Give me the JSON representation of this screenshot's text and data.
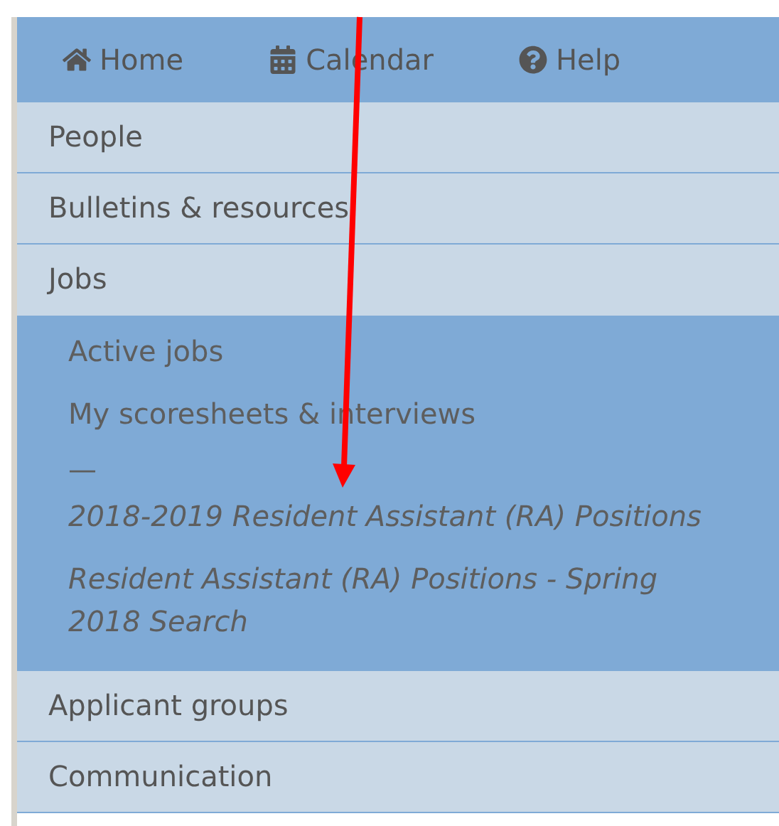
{
  "top_nav": [
    {
      "kind": "home",
      "label": "Home"
    },
    {
      "kind": "calendar",
      "label": "Calendar"
    },
    {
      "kind": "help",
      "label": "Help"
    }
  ],
  "menu": [
    {
      "label": "People",
      "expanded": false
    },
    {
      "label": "Bulletins & resources",
      "expanded": false
    },
    {
      "label": "Jobs",
      "expanded": true,
      "children": [
        {
          "kind": "link",
          "label": "Active jobs"
        },
        {
          "kind": "link",
          "label": "My scoresheets & interviews"
        },
        {
          "kind": "divider",
          "label": "—"
        },
        {
          "kind": "job",
          "label": "2018-2019 Resident Assistant (RA) Positions"
        },
        {
          "kind": "job",
          "label": "Resident Assistant (RA) Positions - Spring 2018 Search"
        }
      ]
    },
    {
      "label": "Applicant groups",
      "expanded": false
    },
    {
      "label": "Communication",
      "expanded": false
    }
  ]
}
